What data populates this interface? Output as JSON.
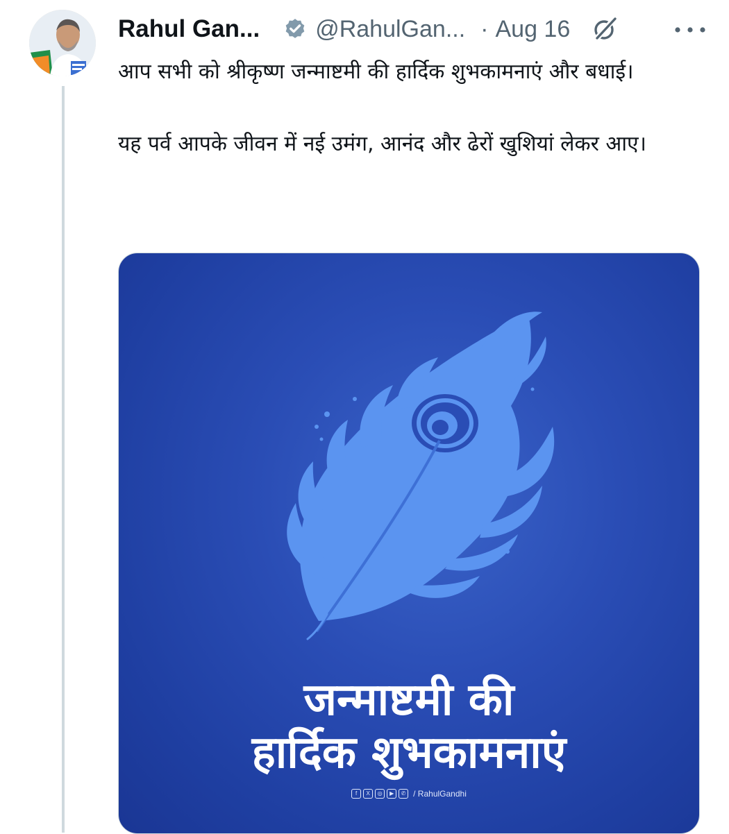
{
  "tweet": {
    "author_name": "Rahul Gan...",
    "handle": "@RahulGan...",
    "separator": "·",
    "date": "Aug 16",
    "text_paragraphs": [
      "आप सभी को श्रीकृष्ण जन्माष्टमी की हार्दिक शुभकामनाएं और बधाई।",
      "यह पर्व आपके जीवन में नई उमंग, आनंद और ढेरों खुशियां लेकर आए।"
    ]
  },
  "media": {
    "greeting_line1": "जन्माष्टमी की",
    "greeting_line2": "हार्दिक शुभकामनाएं",
    "social_icons": [
      "facebook-icon",
      "x-icon",
      "instagram-icon",
      "youtube-icon",
      "whatsapp-icon"
    ],
    "social_handle": "/ RahulGandhi",
    "background_color": "#2a4db5",
    "feather_color": "#5b94f0"
  },
  "colors": {
    "text": "#0f1419",
    "secondary_text": "#536471",
    "thread_line": "#cfd9de"
  }
}
